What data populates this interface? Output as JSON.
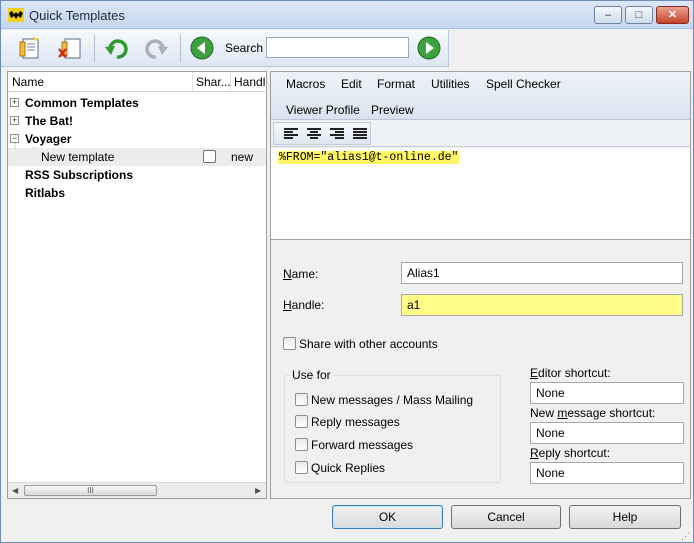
{
  "window": {
    "title": "Quick Templates",
    "minimize_glyph": "–",
    "maximize_glyph": "□",
    "close_glyph": "✕"
  },
  "toolbar": {
    "search_label": "Search",
    "search_value": "",
    "buttons": [
      "new-template-icon",
      "delete-template-icon",
      "undo-icon",
      "redo-icon",
      "search-back-icon",
      "search-forward-icon"
    ]
  },
  "tree": {
    "columns": {
      "name": "Name",
      "share": "Shar...",
      "handle": "Handl"
    },
    "items": [
      {
        "label": "Common Templates",
        "bold": true,
        "expander": "+"
      },
      {
        "label": "The Bat!",
        "bold": true,
        "expander": "+"
      },
      {
        "label": "Voyager",
        "bold": true,
        "expander": "−"
      },
      {
        "label": "New template",
        "bold": false,
        "share": false,
        "handle": "new",
        "selected": true
      },
      {
        "label": "RSS Subscriptions",
        "bold": true
      },
      {
        "label": "Ritlabs",
        "bold": true
      }
    ],
    "scroll_thumb_glyph": "III"
  },
  "menu": {
    "items": [
      "Macros",
      "Edit",
      "Format",
      "Utilities",
      "Spell Checker",
      "Viewer Profile",
      "Preview"
    ]
  },
  "format_icons": [
    "align-left-icon",
    "align-center-icon",
    "align-right-icon",
    "justify-icon"
  ],
  "editor": {
    "text": "%FROM=\"alias1@t-online.de\""
  },
  "form": {
    "name_label_u": "N",
    "name_label_rest": "ame:",
    "name_value": "Alias1",
    "handle_label_u": "H",
    "handle_label_rest": "andle:",
    "handle_value": "a1",
    "share_label": "Share with other accounts",
    "share_checked": false,
    "use_for_title": "Use for",
    "use_for": [
      {
        "label": "New messages / Mass Mailing",
        "checked": false
      },
      {
        "label": "Reply messages",
        "checked": false
      },
      {
        "label": "Forward messages",
        "checked": false
      },
      {
        "label": "Quick Replies",
        "checked": false
      }
    ],
    "editor_shortcut_pre": "E",
    "editor_shortcut_rest": "ditor shortcut:",
    "editor_shortcut_value": "None",
    "new_msg_shortcut_pre": "New ",
    "new_msg_shortcut_u": "m",
    "new_msg_shortcut_rest": "essage shortcut:",
    "new_msg_shortcut_value": "None",
    "reply_shortcut_pre": "R",
    "reply_shortcut_rest": "eply shortcut:",
    "reply_shortcut_value": "None"
  },
  "buttons": {
    "ok": "OK",
    "cancel": "Cancel",
    "help": "Help"
  }
}
